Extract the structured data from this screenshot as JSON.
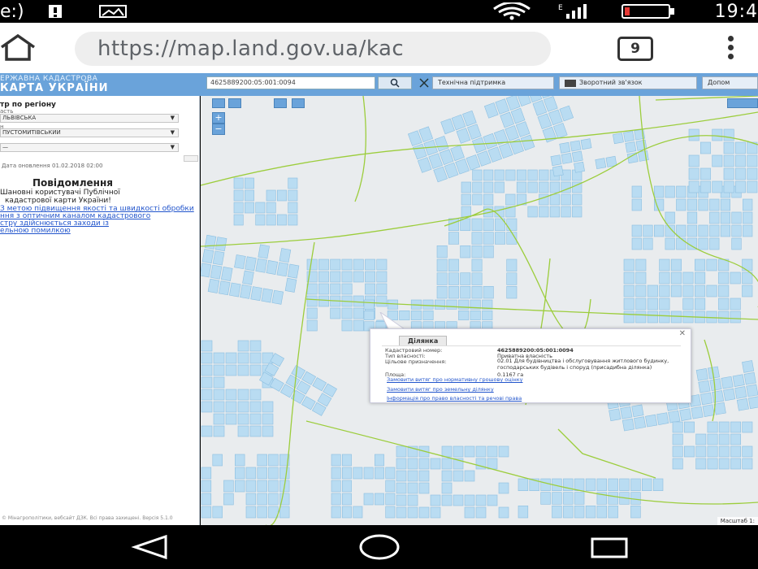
{
  "status_bar": {
    "left_text": "e:)",
    "time": "19:4",
    "battery_color": "#e53935"
  },
  "browser": {
    "url": "https://map.land.gov.ua/kac",
    "tab_count": "9",
    "icons": [
      "home-icon",
      "tabs-icon",
      "overflow-menu-icon"
    ]
  },
  "site_header": {
    "logo_line1": "ЕРЖАВНА КАДАСТРОВА",
    "logo_line2": "КАРТА УКРАЇНИ",
    "search_value": "4625889200:05:001:0094",
    "search_icon": "search-icon",
    "tech_support": "Технічна підтримка",
    "feedback": "Зворотний зв'язок",
    "help": "Допом",
    "accent_color": "#6aa3da"
  },
  "left_panel": {
    "title": "тр по регіону",
    "fields": [
      {
        "label": "асть",
        "value": "ЛЬВІВСЬКА"
      },
      {
        "label": "н",
        "value": "ПУСТОМИТІВСЬКИЙ"
      },
      {
        "label": "",
        "value": "—"
      }
    ],
    "date_text": "Дата оновлення 01.02.2018 02:00",
    "message_title": "Повідомлення",
    "message_lines": [
      "Шановні користувачі Публічної",
      "кадастрової карти України!"
    ],
    "links": [
      "З метою підвищення якості та швидкості обробки",
      "ння з оптичним каналом кадастрового",
      "стру здійснюється заходи із",
      "ельною помилкою"
    ],
    "footer": "© Мінагрополітики, вебсайт ДЗК. Всі права захищені. Версія 5.1.0"
  },
  "popup": {
    "tab": "Ділянка",
    "rows": [
      {
        "label": "Кадастровий номер:",
        "value": "4625889200:05:001:0094"
      },
      {
        "label": "Тип власності:",
        "value": "Приватна власність"
      },
      {
        "label": "Цільове призначення:",
        "value": "02.01 Для будівництва і обслуговування житлового будинку, господарських будівель і споруд (присадибна ділянка)"
      },
      {
        "label": "Площа:",
        "value": "0.1167 га"
      }
    ],
    "links": [
      "Замовити витяг про нормативну грошову оцінку",
      "Замовити витяг про земельну ділянку",
      "Інформація про право власності та речові права"
    ],
    "close_label": "✕"
  },
  "map": {
    "parcel_fill": "#b9dcf2",
    "parcel_stroke": "#8cbfe0",
    "boundary_color": "#9ccd3c",
    "scale_text": "Масштаб 1:",
    "zoom_in": "+",
    "zoom_out": "−"
  }
}
